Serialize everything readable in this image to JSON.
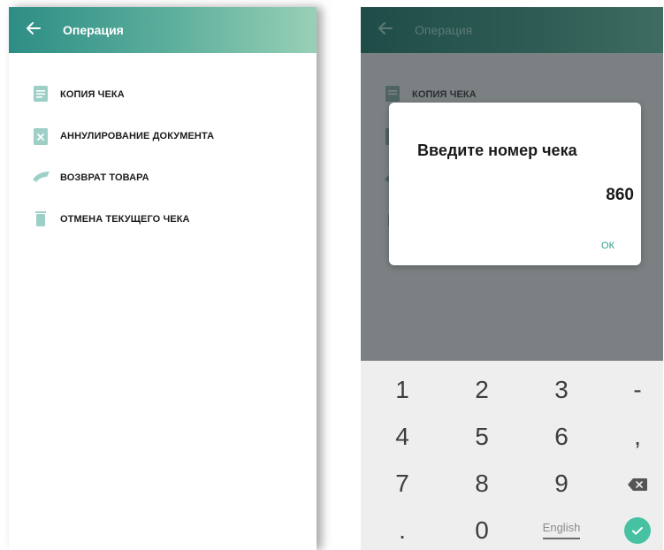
{
  "left": {
    "appbar": {
      "title": "Операция"
    },
    "menu": [
      {
        "label": "КОПИЯ ЧЕКА",
        "icon": "document-copy-icon"
      },
      {
        "label": "АННУЛИРОВАНИЕ ДОКУМЕНТА",
        "icon": "document-cancel-icon"
      },
      {
        "label": "ВОЗВРАТ ТОВАРА",
        "icon": "return-arrow-icon"
      },
      {
        "label": "ОТМЕНА ТЕКУЩЕГО ЧЕКА",
        "icon": "trash-icon"
      }
    ]
  },
  "right": {
    "appbar": {
      "title": "Операция"
    },
    "menu_visible": [
      {
        "label": "КОПИЯ ЧЕКА"
      }
    ],
    "dialog": {
      "title": "Введите номер чека",
      "value": "860",
      "ok_label": "ОК"
    },
    "keyboard": {
      "rows": [
        [
          "1",
          "2",
          "3",
          "-"
        ],
        [
          "4",
          "5",
          "6",
          ","
        ],
        [
          "7",
          "8",
          "9",
          "backspace"
        ],
        [
          ".",
          "0",
          "English",
          "enter"
        ]
      ]
    }
  },
  "colors": {
    "accent": "#2f9d86",
    "appbar_start": "#2d8d85",
    "appbar_end": "#98d0b6",
    "icon": "#8fc8c0",
    "enter_key": "#46c2a2"
  }
}
